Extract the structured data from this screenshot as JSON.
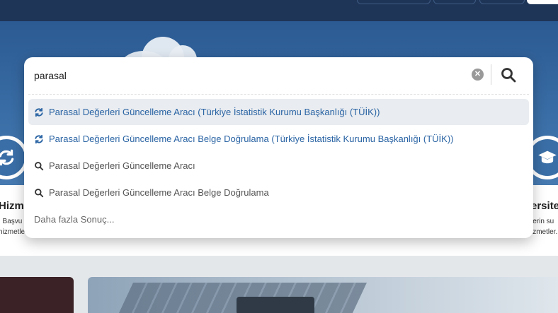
{
  "header": {
    "nav_pills": [
      "",
      "",
      ""
    ]
  },
  "search": {
    "query": "parasal",
    "clear_icon": "clear-icon",
    "button_icon": "search-icon",
    "suggestions": [
      {
        "label": "Parasal Değerleri Güncelleme Aracı (Türkiye İstatistik Kurumu Başkanlığı (TÜİK))",
        "icon": "refresh-icon",
        "kind": "service"
      },
      {
        "label": "Parasal Değerleri Güncelleme Aracı Belge Doğrulama (Türkiye İstatistik Kurumu Başkanlığı (TÜİK))",
        "icon": "refresh-icon",
        "kind": "service"
      },
      {
        "label": "Parasal Değerleri Güncelleme Aracı",
        "icon": "search-icon",
        "kind": "query"
      },
      {
        "label": "Parasal Değerleri Güncelleme Aracı Belge Doğrulama",
        "icon": "search-icon",
        "kind": "query"
      }
    ],
    "more_results": "Daha fazla Sonuç..."
  },
  "services": {
    "left": {
      "title": "Hizme",
      "desc_1": ", Başvu",
      "desc_2": "nizmetler",
      "icon": "refresh-icon"
    },
    "right": {
      "title": "ersite",
      "desc_1": "lerin su",
      "desc_2": "izmetler.",
      "icon": "graduation-cap-icon"
    }
  },
  "colors": {
    "header": "#1f3558",
    "hero": "#3a6ea6",
    "link": "#2a64a4",
    "active_row": "#e9ecf0"
  }
}
